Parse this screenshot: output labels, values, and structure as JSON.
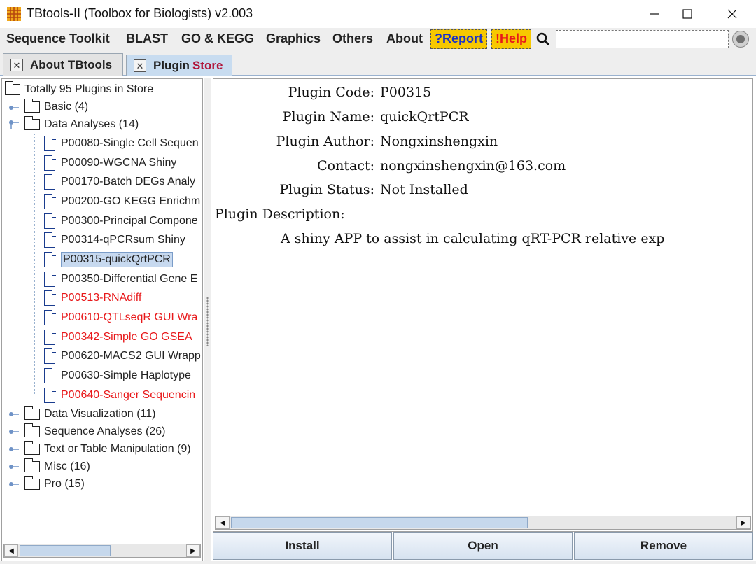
{
  "window": {
    "title": "TBtools-II (Toolbox for Biologists) v2.003",
    "minimize": "—",
    "maximize": "☐",
    "close": "✕"
  },
  "menu": {
    "items": [
      "Sequence Toolkit",
      "BLAST",
      "GO & KEGG",
      "Graphics",
      "Others",
      "About"
    ],
    "report": "?Report",
    "help": "!Help",
    "search_value": ""
  },
  "tabs": [
    {
      "label": "About TBtools",
      "accent": "",
      "active": false
    },
    {
      "label": "Plugin",
      "accent": "Store",
      "active": true
    }
  ],
  "tree": {
    "root": "Totally 95 Plugins in Store",
    "categories": [
      {
        "label": "Basic (4)",
        "expanded": false
      },
      {
        "label": "Data Analyses (14)",
        "expanded": true
      }
    ],
    "plugins": [
      {
        "label": "P00080-Single Cell Sequen",
        "red": false,
        "selected": false
      },
      {
        "label": "P00090-WGCNA Shiny",
        "red": false,
        "selected": false
      },
      {
        "label": "P00170-Batch DEGs Analy",
        "red": false,
        "selected": false
      },
      {
        "label": "P00200-GO KEGG Enrichm",
        "red": false,
        "selected": false
      },
      {
        "label": "P00300-Principal Compone",
        "red": false,
        "selected": false
      },
      {
        "label": "P00314-qPCRsum Shiny",
        "red": false,
        "selected": false
      },
      {
        "label": "P00315-quickQrtPCR",
        "red": false,
        "selected": true
      },
      {
        "label": "P00350-Differential Gene E",
        "red": false,
        "selected": false
      },
      {
        "label": "P00513-RNAdiff",
        "red": true,
        "selected": false
      },
      {
        "label": "P00610-QTLseqR GUI Wra",
        "red": true,
        "selected": false
      },
      {
        "label": "P00342-Simple GO GSEA",
        "red": true,
        "selected": false
      },
      {
        "label": "P00620-MACS2 GUI Wrapp",
        "red": false,
        "selected": false
      },
      {
        "label": "P00630-Simple Haplotype",
        "red": false,
        "selected": false
      },
      {
        "label": "P00640-Sanger Sequencin",
        "red": true,
        "selected": false
      }
    ],
    "more_categories": [
      "Data Visualization (11)",
      "Sequence Analyses (26)",
      "Text or Table Manipulation (9)",
      "Misc (16)",
      "Pro (15)"
    ]
  },
  "details": {
    "code_key": "Plugin Code:",
    "code_val": "P00315",
    "name_key": "Plugin Name:",
    "name_val": "quickQrtPCR",
    "author_key": "Plugin Author:",
    "author_val": "Nongxinshengxin",
    "contact_key": "Contact:",
    "contact_val": "nongxinshengxin@163.com",
    "status_key": "Plugin Status:",
    "status_val": "Not Installed",
    "description_key": "Plugin Description:",
    "description_val": "A shiny APP to assist in calculating qRT-PCR relative exp"
  },
  "buttons": {
    "install": "Install",
    "open": "Open",
    "remove": "Remove"
  },
  "colors": {
    "menu_box": "#f7c800",
    "report_text": "#1a31c9",
    "help_text": "#e8181a",
    "not_installed_plugin": "#e8181a",
    "tab_active": "#c8dcf0",
    "tab_accent": "#b0143a"
  }
}
